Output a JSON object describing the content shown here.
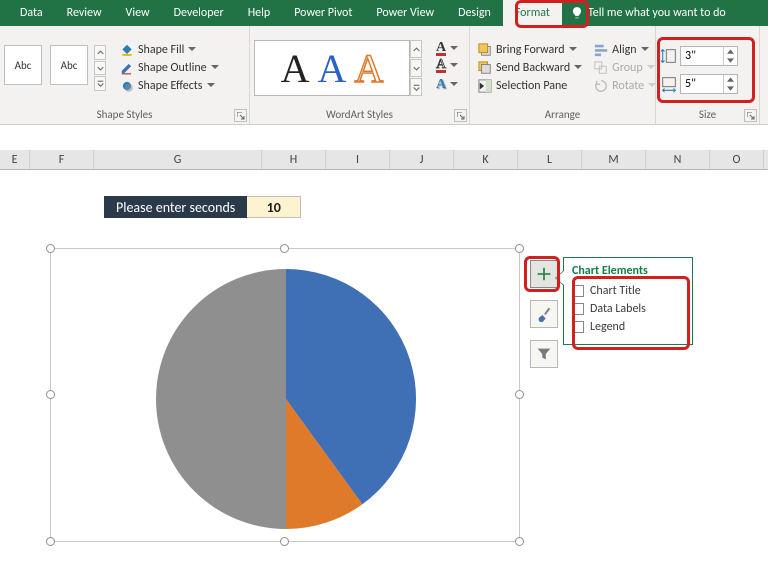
{
  "tabs": [
    "Data",
    "Review",
    "View",
    "Developer",
    "Help",
    "Power Pivot",
    "Power View",
    "Design",
    "Format"
  ],
  "active_tab": "Format",
  "tell_me": "Tell me what you want to do",
  "group_labels": {
    "shape": "Shape Styles",
    "wordart": "WordArt Styles",
    "arrange": "Arrange",
    "size": "Size"
  },
  "shape_menu": {
    "fill": "Shape Fill",
    "outline": "Shape Outline",
    "effects": "Shape Effects"
  },
  "shape_box_label": "Abc",
  "arrange": {
    "forward": "Bring Forward",
    "backward": "Send Backward",
    "pane": "Selection Pane",
    "align": "Align",
    "group": "Group",
    "rotate": "Rotate"
  },
  "size": {
    "h": "3\"",
    "w": "5\""
  },
  "sheet": {
    "cols": [
      "E",
      "F",
      "G",
      "H",
      "I",
      "J",
      "K",
      "L",
      "M",
      "N",
      "O"
    ],
    "enter_label": "Please enter seconds",
    "enter_value": "10"
  },
  "chart_data": {
    "type": "pie",
    "series": [
      {
        "name": "",
        "values": [
          50,
          10,
          40
        ]
      }
    ],
    "categories": [
      "Gray",
      "Orange",
      "Blue"
    ],
    "colors": [
      "#8f8f8f",
      "#e07a2b",
      "#3f6fb5"
    ],
    "title": "",
    "legend": false,
    "data_labels": false
  },
  "flyout": {
    "title": "Chart Elements",
    "items": [
      "Chart Title",
      "Data Labels",
      "Legend"
    ]
  }
}
